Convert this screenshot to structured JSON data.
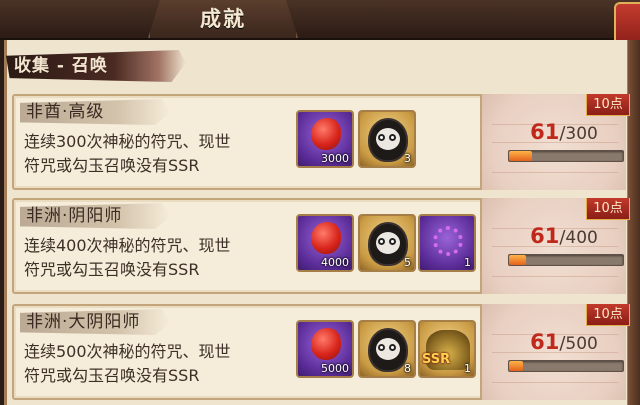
{
  "header": {
    "title": "成就"
  },
  "section": {
    "title": "收集 - 召唤"
  },
  "achievements": [
    {
      "name": "非酋·高级",
      "description_line1": "连续300次神秘的符咒、现世",
      "description_line2": "符咒或勾玉召唤没有SSR",
      "rewards": [
        {
          "kind": "jade",
          "count": "3000"
        },
        {
          "kind": "daruma",
          "count": "3"
        }
      ],
      "points": "10点",
      "progress": {
        "current": "61",
        "separator": "/",
        "goal": "300",
        "fraction": 0.2033
      }
    },
    {
      "name": "非洲·阴阳师",
      "description_line1": "连续400次神秘的符咒、现世",
      "description_line2": "符咒或勾玉召唤没有SSR",
      "rewards": [
        {
          "kind": "jade",
          "count": "4000"
        },
        {
          "kind": "daruma",
          "count": "5"
        },
        {
          "kind": "chain",
          "count": "1"
        }
      ],
      "points": "10点",
      "progress": {
        "current": "61",
        "separator": "/",
        "goal": "400",
        "fraction": 0.1525
      }
    },
    {
      "name": "非洲·大阴阳师",
      "description_line1": "连续500次神秘的符咒、现世",
      "description_line2": "符咒或勾玉召唤没有SSR",
      "rewards": [
        {
          "kind": "jade",
          "count": "5000"
        },
        {
          "kind": "daruma",
          "count": "8"
        },
        {
          "kind": "ssr",
          "label": "SSR",
          "count": "1"
        }
      ],
      "points": "10点",
      "progress": {
        "current": "61",
        "separator": "/",
        "goal": "500",
        "fraction": 0.122
      }
    }
  ],
  "icons": {
    "close": "close-icon",
    "jade": "magatama-jade-icon",
    "daruma": "black-daruma-icon",
    "chain": "purple-chain-icon",
    "ssr": "ssr-summon-icon"
  },
  "colors": {
    "accent_red": "#c1281c",
    "paper": "#efe5cf",
    "bar_fill": "#e3621c"
  }
}
